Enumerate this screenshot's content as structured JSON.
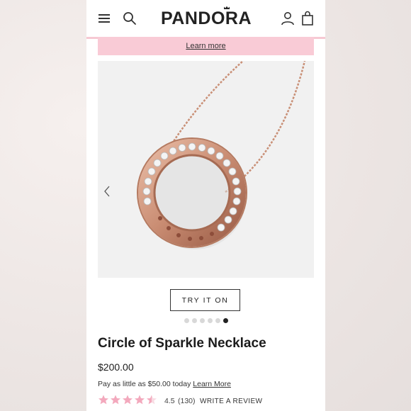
{
  "header": {
    "logo_text": "PANDORA",
    "icons": [
      "menu-icon",
      "search-icon",
      "account-icon",
      "bag-icon"
    ],
    "accent_color": "#f6c9d3"
  },
  "banner": {
    "link_text": "Learn more",
    "background": "#f9cbd6"
  },
  "carousel": {
    "slide_count": 6,
    "active_index": 5
  },
  "product": {
    "try_on_label": "TRY IT ON",
    "title": "Circle of Sparkle Necklace",
    "price": "$200.00",
    "installment_text": "Pay as little as $50.00 today",
    "installment_link": "Learn More",
    "rating": {
      "stars": 4.5,
      "value": "4.5",
      "count": "(130)",
      "write_review_label": "WRITE A REVIEW",
      "star_color": "#f3a9bd"
    }
  }
}
